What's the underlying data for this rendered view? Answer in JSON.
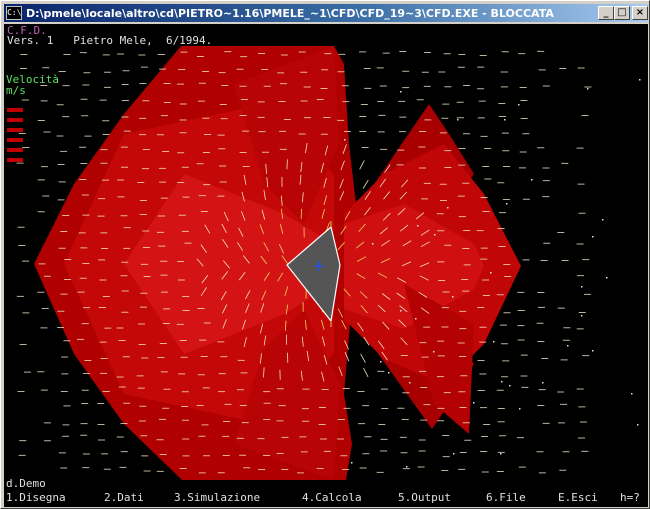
{
  "window": {
    "title": "D:\\pmele\\locale\\altro\\cd\\PIETRO~1.16\\PMELE_~1\\CFD\\CFD_19~3\\CFD.EXE - BLOCCATA",
    "system_icon": "C:\\",
    "buttons": {
      "minimize": "_",
      "maximize": "□",
      "close": "×"
    }
  },
  "console": {
    "program_title": "C.F.D.",
    "version_line": "Vers. 1   Pietro Mele,  6/1994.",
    "legend": {
      "title": "Velocità",
      "unit": "m/s",
      "swatch_colors": [
        "#c00000",
        "#c00000",
        "#c00000",
        "#c00000",
        "#c00000",
        "#c00000"
      ]
    },
    "mode_label": "d.Demo",
    "menu": [
      {
        "key": "1",
        "label": "1.Disegna"
      },
      {
        "key": "2",
        "label": "2.Dati"
      },
      {
        "key": "3",
        "label": "3.Simulazione"
      },
      {
        "key": "4",
        "label": "4.Calcola"
      },
      {
        "key": "5",
        "label": "5.Output"
      },
      {
        "key": "6",
        "label": "6.File"
      },
      {
        "key": "E",
        "label": "E.Esci"
      },
      {
        "key": "h",
        "label": "h=?"
      }
    ]
  },
  "colors": {
    "console_bg": "#000000",
    "field_dark": "#a80000",
    "field_mid": "#c80a0a",
    "field_light": "#dd1616",
    "obstacle": "#555555",
    "obstacle_outline": "#ffffff",
    "marker": "#2050ff"
  },
  "icons": {
    "system": "console-icon",
    "obstacle_marker": "plus-icon"
  }
}
